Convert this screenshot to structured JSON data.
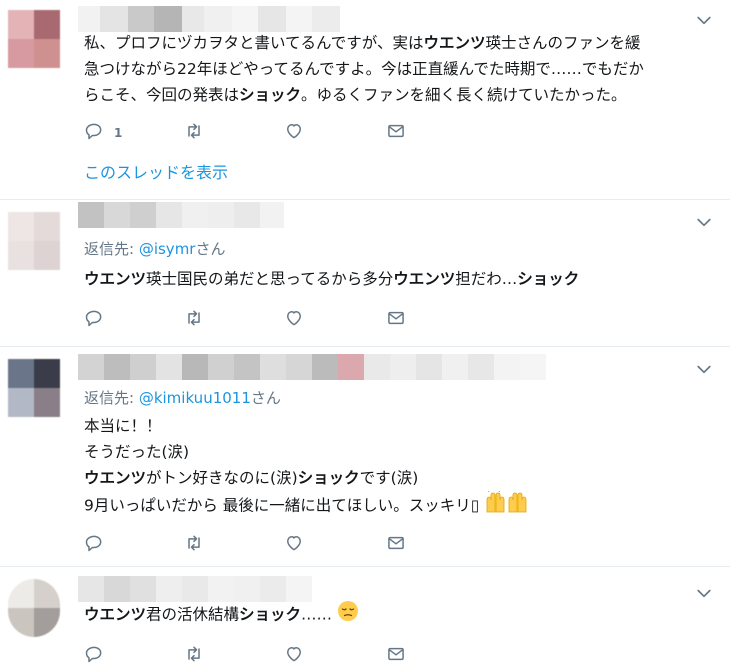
{
  "colors": {
    "link": "#1b95e0",
    "icon": "#657786",
    "text": "#14171a",
    "divider": "#e6ecf0"
  },
  "icons": [
    "reply-icon",
    "retweet-icon",
    "like-icon",
    "dm-icon",
    "chevron-down-icon"
  ],
  "tweets": [
    {
      "body_lines": [
        [
          {
            "t": "私、プロフにヅカヲタと書いてるんですが、実は"
          },
          {
            "t": "ウエンツ",
            "b": true
          },
          {
            "t": "瑛士さんのファンを緩"
          }
        ],
        [
          {
            "t": "急つけながら22年ほどやってるんですよ。今は正直緩んでた時期で……でもだか"
          }
        ],
        [
          {
            "t": "らこそ、今回の発表は"
          },
          {
            "t": "ショック",
            "b": true
          },
          {
            "t": "。ゆるくファンを細く長く続けていたかった。"
          }
        ]
      ],
      "reply_count": "1",
      "thread_link": "このスレッドを表示"
    },
    {
      "reply_prefix": "返信先: ",
      "reply_handle": "@isymr",
      "reply_suffix": "さん",
      "body_lines": [
        [
          {
            "t": "ウエンツ",
            "b": true
          },
          {
            "t": "瑛士国民の弟だと思ってるから多分"
          },
          {
            "t": "ウエンツ",
            "b": true
          },
          {
            "t": "担だわ…"
          },
          {
            "t": "ショック",
            "b": true
          }
        ]
      ]
    },
    {
      "reply_prefix": "返信先: ",
      "reply_handle": "@kimikuu1011",
      "reply_suffix": "さん",
      "body_lines": [
        [
          {
            "t": "本当に！！"
          }
        ],
        [
          {
            "t": "そうだった(涙)"
          }
        ],
        [
          {
            "t": "ウエンツ",
            "b": true
          },
          {
            "t": "がトン好きなのに(涙)"
          },
          {
            "t": "ショック",
            "b": true
          },
          {
            "t": "です(涙)"
          }
        ],
        [
          {
            "t": "9月いっぱいだから 最後に一緒に出てほしい。スッキリ▯"
          }
        ]
      ],
      "trailing_emoji": "raising-hands-emoji"
    },
    {
      "body_lines": [
        [
          {
            "t": "ウエンツ",
            "b": true
          },
          {
            "t": "君の活休結構"
          },
          {
            "t": "ショック",
            "b": true
          },
          {
            "t": "……"
          }
        ]
      ],
      "trailing_emoji": "pensive-face-emoji"
    }
  ]
}
